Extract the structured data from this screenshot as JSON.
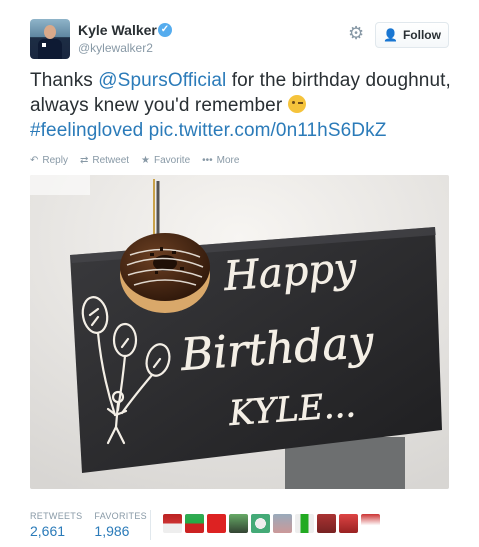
{
  "author": {
    "name": "Kyle Walker",
    "handle": "@kylewalker2",
    "verified_icon": "verified-badge-icon"
  },
  "header": {
    "follow_label": "Follow",
    "settings_icon": "gear-icon"
  },
  "tweet": {
    "text_before": "Thanks ",
    "mention": "@SpursOfficial",
    "text_middle": " for the birthday doughnut, always knew you'd remember ",
    "hashtag": "#feelingloved",
    "pic_link": "pic.twitter.com/0n11hS6DkZ"
  },
  "actions": {
    "reply": "Reply",
    "retweet": "Retweet",
    "favorite": "Favorite",
    "more": "More"
  },
  "photo": {
    "board_lines": [
      "Happy",
      "Birthday",
      "KYLE..."
    ]
  },
  "stats": {
    "retweets_label": "RETWEETS",
    "retweets_value": "2,661",
    "favorites_label": "FAVORITES",
    "favorites_value": "1,986"
  },
  "colors": {
    "link": "#2b7bb9",
    "muted": "#8899a6",
    "verified": "#55acee",
    "slate": "#2a2a2c"
  }
}
